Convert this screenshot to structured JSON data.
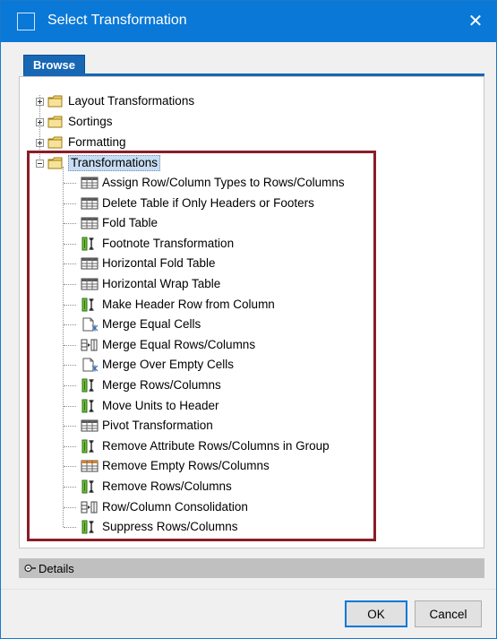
{
  "window": {
    "title": "Select Transformation",
    "close_glyph": "✕"
  },
  "tabs": [
    {
      "label": "Browse",
      "active": true
    }
  ],
  "tree": {
    "groups": [
      {
        "label": "Layout Transformations",
        "expanded": false
      },
      {
        "label": "Sortings",
        "expanded": false
      },
      {
        "label": "Formatting",
        "expanded": false
      },
      {
        "label": "Transformations",
        "expanded": true,
        "selected": true
      }
    ],
    "children": [
      {
        "label": "Assign Row/Column Types to Rows/Columns",
        "icon": "table-icon"
      },
      {
        "label": "Delete Table if Only Headers or Footers",
        "icon": "table-icon"
      },
      {
        "label": "Fold Table",
        "icon": "table-icon"
      },
      {
        "label": "Footnote Transformation",
        "icon": "row-column-icon"
      },
      {
        "label": "Horizontal Fold Table",
        "icon": "table-icon"
      },
      {
        "label": "Horizontal Wrap Table",
        "icon": "table-icon"
      },
      {
        "label": "Make Header Row from Column",
        "icon": "row-column-icon"
      },
      {
        "label": "Merge Equal Cells",
        "icon": "merge-cells-icon"
      },
      {
        "label": "Merge Equal Rows/Columns",
        "icon": "merge-rows-icon"
      },
      {
        "label": "Merge Over Empty Cells",
        "icon": "merge-cells-icon"
      },
      {
        "label": "Merge Rows/Columns",
        "icon": "row-column-icon"
      },
      {
        "label": "Move Units to Header",
        "icon": "row-column-icon"
      },
      {
        "label": "Pivot Transformation",
        "icon": "table-icon"
      },
      {
        "label": "Remove Attribute Rows/Columns in Group",
        "icon": "row-column-icon"
      },
      {
        "label": "Remove Empty Rows/Columns",
        "icon": "table-orange-icon"
      },
      {
        "label": "Remove Rows/Columns",
        "icon": "row-column-icon"
      },
      {
        "label": "Row/Column Consolidation",
        "icon": "merge-rows-icon"
      },
      {
        "label": "Suppress Rows/Columns",
        "icon": "row-column-icon"
      }
    ]
  },
  "details": {
    "label": "Details",
    "icon": "collapse-toggle-icon"
  },
  "buttons": {
    "ok": "OK",
    "cancel": "Cancel"
  },
  "colors": {
    "titlebar": "#0a78d7",
    "tab_active": "#1767b5",
    "highlight_box": "#8b1d27",
    "details_bar": "#c0c0c0"
  }
}
